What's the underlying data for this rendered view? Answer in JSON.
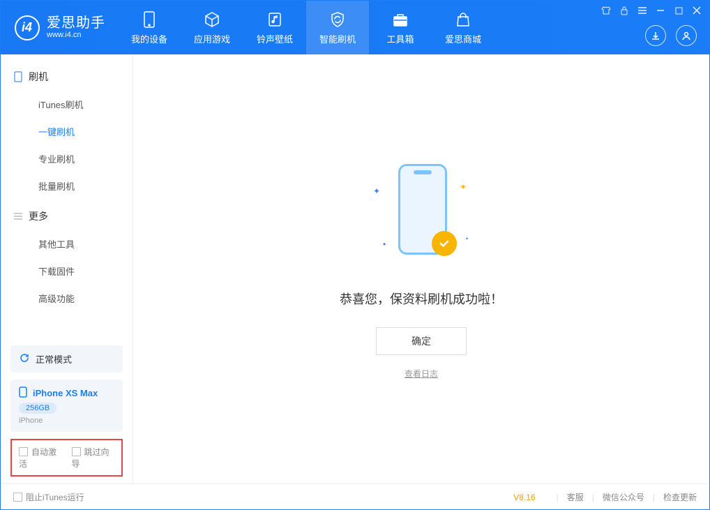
{
  "brand": {
    "name": "爱思助手",
    "domain": "www.i4.cn"
  },
  "nav": {
    "tabs": [
      {
        "label": "我的设备"
      },
      {
        "label": "应用游戏"
      },
      {
        "label": "铃声壁纸"
      },
      {
        "label": "智能刷机"
      },
      {
        "label": "工具箱"
      },
      {
        "label": "爱思商城"
      }
    ]
  },
  "sidebar": {
    "section1_title": "刷机",
    "items1": [
      {
        "label": "iTunes刷机"
      },
      {
        "label": "一键刷机"
      },
      {
        "label": "专业刷机"
      },
      {
        "label": "批量刷机"
      }
    ],
    "section2_title": "更多",
    "items2": [
      {
        "label": "其他工具"
      },
      {
        "label": "下载固件"
      },
      {
        "label": "高级功能"
      }
    ]
  },
  "device_panel": {
    "mode_label": "正常模式",
    "device_name": "iPhone XS Max",
    "capacity": "256GB",
    "device_type": "iPhone"
  },
  "options": {
    "auto_activate": "自动激活",
    "skip_setup": "跳过向导"
  },
  "content": {
    "success_text": "恭喜您，保资料刷机成功啦！",
    "ok_button": "确定",
    "view_log": "查看日志"
  },
  "footer": {
    "block_itunes": "阻止iTunes运行",
    "version": "V8.16",
    "links": [
      "客服",
      "微信公众号",
      "检查更新"
    ]
  }
}
